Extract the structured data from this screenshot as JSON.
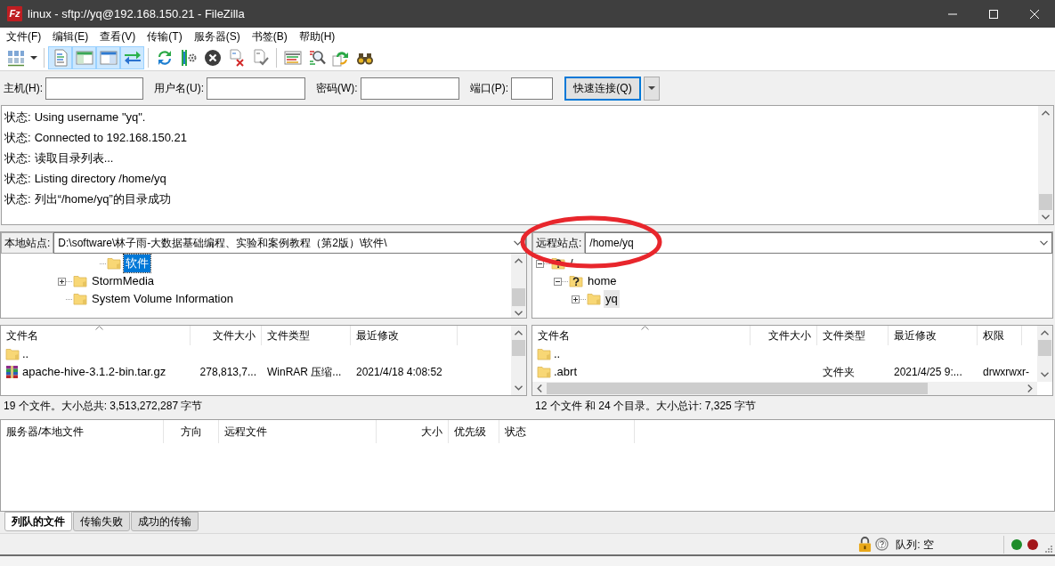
{
  "window": {
    "logo": "Fz",
    "title": "linux - sftp://yq@192.168.150.21 - FileZilla"
  },
  "menu": [
    "文件(F)",
    "编辑(E)",
    "查看(V)",
    "传输(T)",
    "服务器(S)",
    "书签(B)",
    "帮助(H)"
  ],
  "toolbar": [
    [
      {
        "kind": "site-manager",
        "pressed": false
      },
      {
        "kind": "dropdown",
        "pressed": false
      }
    ],
    [
      {
        "kind": "message-log",
        "pressed": true
      },
      {
        "kind": "local-tree",
        "pressed": true
      },
      {
        "kind": "remote-tree",
        "pressed": true
      },
      {
        "kind": "transfer-queue",
        "pressed": true
      }
    ],
    [
      {
        "kind": "refresh",
        "pressed": false
      },
      {
        "kind": "process-queue",
        "pressed": false
      },
      {
        "kind": "cancel",
        "pressed": false
      },
      {
        "kind": "disconnect",
        "pressed": false
      },
      {
        "kind": "reconnect",
        "pressed": false
      }
    ],
    [
      {
        "kind": "filter",
        "pressed": false
      },
      {
        "kind": "compare",
        "pressed": false
      },
      {
        "kind": "sync",
        "pressed": false
      },
      {
        "kind": "search",
        "pressed": false
      }
    ]
  ],
  "quickconnect": {
    "fields": [
      {
        "kind": "host",
        "label": "主机(H):"
      },
      {
        "kind": "user",
        "label": "用户名(U):"
      },
      {
        "kind": "password",
        "label": "密码(W):"
      },
      {
        "kind": "port",
        "label": "端口(P):"
      }
    ],
    "button": "快速连接(Q)"
  },
  "message_log": [
    {
      "label": "状态:",
      "text": "Using username \"yq\"."
    },
    {
      "label": "状态:",
      "text": "Connected to 192.168.150.21"
    },
    {
      "label": "状态:",
      "text": "读取目录列表..."
    },
    {
      "label": "状态:",
      "text": "Listing directory /home/yq"
    },
    {
      "label": "状态:",
      "text": "列出“/home/yq”的目录成功"
    }
  ],
  "local": {
    "active": true,
    "site_label": "本地站点:",
    "path": "D:\\software\\林子雨-大数据基础编程、实验和案例教程（第2版）\\软件\\",
    "tree": [
      {
        "children": [
          {
            "children": [
              {
                "label": "软件",
                "kind": "folder",
                "selected": true
              }
            ]
          }
        ]
      },
      {
        "label": "StormMedia",
        "kind": "folder",
        "expanded": false,
        "selected": false
      },
      {
        "label": "System Volume Information",
        "kind": "folder",
        "selected": false
      }
    ],
    "columns": [
      {
        "label": "文件名",
        "sorted": true
      },
      {
        "label": "文件大小",
        "sorted": false
      },
      {
        "label": "文件类型",
        "sorted": false
      },
      {
        "label": "最近修改",
        "sorted": false
      }
    ],
    "rows": [
      {
        "kind": "folder",
        "name": ".."
      },
      {
        "kind": "archive",
        "name": "apache-hive-3.1.2-bin.tar.gz",
        "size": "278,813,7...",
        "type": "WinRAR 压缩...",
        "modified": "2021/4/18 4:08:52"
      }
    ],
    "summary": "19 个文件。大小总共: 3,513,272,287 字节"
  },
  "remote": {
    "active": false,
    "site_label": "远程站点:",
    "path": "/home/yq",
    "tree": [
      {
        "label": "/",
        "kind": "unknown",
        "expanded": true,
        "selected": false,
        "children": [
          {
            "label": "home",
            "kind": "unknown",
            "expanded": true,
            "selected": false,
            "children": [
              {
                "label": "yq",
                "kind": "folder",
                "expanded": false,
                "selected": true
              }
            ]
          }
        ]
      }
    ],
    "columns": [
      {
        "label": "文件名",
        "sorted": true
      },
      {
        "label": "文件大小",
        "sorted": false
      },
      {
        "label": "文件类型",
        "sorted": false
      },
      {
        "label": "最近修改",
        "sorted": false
      },
      {
        "label": "权限",
        "sorted": false
      }
    ],
    "rows": [
      {
        "kind": "folder",
        "name": ".."
      },
      {
        "kind": "folder",
        "name": ".abrt",
        "type": "文件夹",
        "modified": "2021/4/25 9:...",
        "permissions": "drwxrwxr-"
      }
    ],
    "summary": "12 个文件 和 24 个目录。大小总计: 7,325 字节"
  },
  "queue": {
    "columns": [
      "服务器/本地文件",
      "方向",
      "远程文件",
      "大小",
      "优先级",
      "状态"
    ],
    "tabs": [
      {
        "label": "列队的文件",
        "selected": true
      },
      {
        "label": "传输失败",
        "selected": false
      },
      {
        "label": "成功的传输",
        "selected": false
      }
    ]
  },
  "status_bar": {
    "queue": "队列: 空",
    "leds": [
      {
        "color": "#1e8c2a"
      },
      {
        "color": "#a3161a"
      }
    ]
  },
  "annotation": {
    "kind": "ellipse"
  }
}
